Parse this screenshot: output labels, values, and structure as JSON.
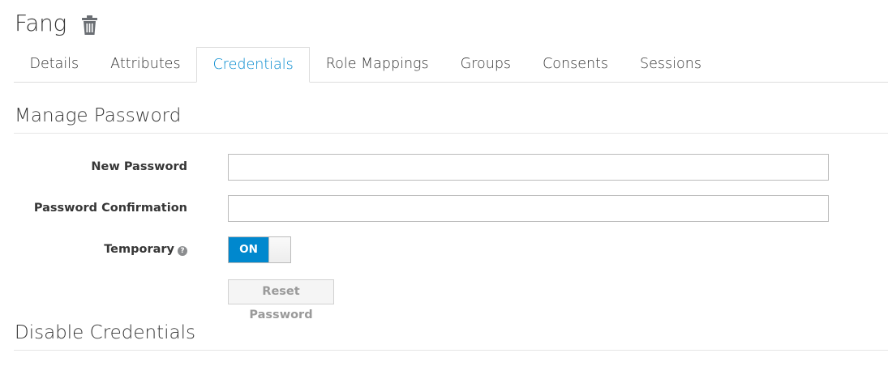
{
  "header": {
    "title": "Fang",
    "delete_icon": "trash-icon"
  },
  "tabs": [
    {
      "label": "Details",
      "active": false
    },
    {
      "label": "Attributes",
      "active": false
    },
    {
      "label": "Credentials",
      "active": true
    },
    {
      "label": "Role Mappings",
      "active": false
    },
    {
      "label": "Groups",
      "active": false
    },
    {
      "label": "Consents",
      "active": false
    },
    {
      "label": "Sessions",
      "active": false
    }
  ],
  "manage_password": {
    "heading": "Manage Password",
    "new_password_label": "New Password",
    "new_password_value": "",
    "confirmation_label": "Password Confirmation",
    "confirmation_value": "",
    "temporary_label": "Temporary",
    "temporary_help_icon": "question-circle-icon",
    "temporary_toggle_text": "ON",
    "temporary_on": true,
    "reset_button_label": "Reset Password",
    "reset_button_disabled": true
  },
  "disable_credentials": {
    "heading": "Disable Credentials"
  },
  "colors": {
    "accent": "#0088ce",
    "text": "#363636",
    "border": "#dddddd"
  }
}
